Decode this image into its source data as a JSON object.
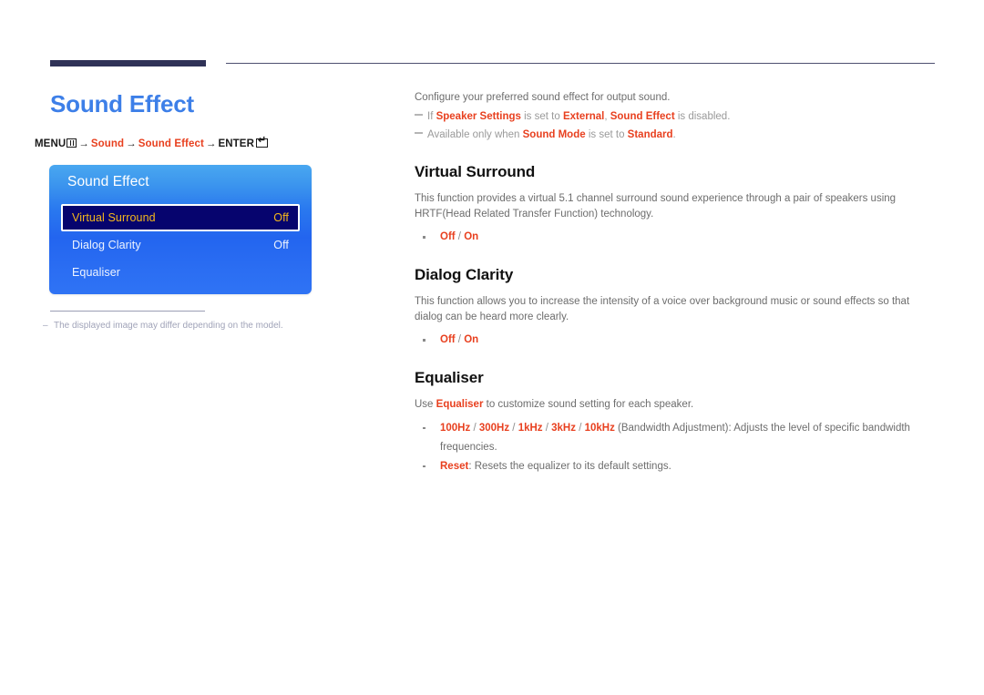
{
  "page": {
    "title": "Sound Effect",
    "accent_blue": "#3d7fe8",
    "accent_red": "#e8401f",
    "rule_navy": "#2f3257"
  },
  "menu_path": {
    "menu_label": "MENU",
    "menu_icon": "menu-grid-icon",
    "arrow": "→",
    "steps": [
      "Sound",
      "Sound Effect"
    ],
    "enter_label": "ENTER",
    "enter_icon": "enter-key-icon"
  },
  "osd": {
    "title": "Sound Effect",
    "highlight_bg": "#06046e",
    "highlight_text": "#f5b81c",
    "rows": [
      {
        "label": "Virtual Surround",
        "value": "Off",
        "selected": true
      },
      {
        "label": "Dialog Clarity",
        "value": "Off",
        "selected": false
      },
      {
        "label": "Equaliser",
        "value": "",
        "selected": false
      }
    ]
  },
  "left_footnote": {
    "dash": "–",
    "text": "The displayed image may differ depending on the model."
  },
  "content": {
    "intro": "Configure your preferred sound effect for output sound.",
    "notes": [
      {
        "parts": [
          {
            "t": "If ",
            "b": false
          },
          {
            "t": "Speaker Settings",
            "b": true
          },
          {
            "t": " is set to ",
            "b": false
          },
          {
            "t": "External",
            "b": true
          },
          {
            "t": ", ",
            "b": false
          },
          {
            "t": "Sound Effect",
            "b": true
          },
          {
            "t": " is disabled.",
            "b": false
          }
        ]
      },
      {
        "parts": [
          {
            "t": "Available only when ",
            "b": false
          },
          {
            "t": "Sound Mode",
            "b": true
          },
          {
            "t": " is set to ",
            "b": false
          },
          {
            "t": "Standard",
            "b": true
          },
          {
            "t": ".",
            "b": false
          }
        ]
      }
    ],
    "sections": [
      {
        "heading": "Virtual Surround",
        "body": "This function provides a virtual 5.1 channel surround sound experience through a pair of speakers using HRTF(Head Related Transfer Function) technology.",
        "bullets": [
          {
            "parts": [
              {
                "t": "Off",
                "b": true
              },
              {
                "t": " / ",
                "b": false,
                "sep": true
              },
              {
                "t": "On",
                "b": true
              }
            ]
          }
        ]
      },
      {
        "heading": "Dialog Clarity",
        "body": "This function allows you to increase the intensity of a voice over background music or sound effects so that dialog can be heard more clearly.",
        "bullets": [
          {
            "parts": [
              {
                "t": "Off",
                "b": true
              },
              {
                "t": " / ",
                "b": false,
                "sep": true
              },
              {
                "t": "On",
                "b": true
              }
            ]
          }
        ]
      },
      {
        "heading": "Equaliser",
        "body_parts": [
          {
            "t": "Use ",
            "b": false
          },
          {
            "t": "Equaliser",
            "b": true
          },
          {
            "t": " to customize sound setting for each speaker.",
            "b": false
          }
        ],
        "bullets": [
          {
            "parts": [
              {
                "t": "100Hz",
                "b": true
              },
              {
                "t": " / ",
                "b": false,
                "sep": true
              },
              {
                "t": "300Hz",
                "b": true
              },
              {
                "t": " / ",
                "b": false,
                "sep": true
              },
              {
                "t": "1kHz",
                "b": true
              },
              {
                "t": " / ",
                "b": false,
                "sep": true
              },
              {
                "t": "3kHz",
                "b": true
              },
              {
                "t": " / ",
                "b": false,
                "sep": true
              },
              {
                "t": "10kHz",
                "b": true
              },
              {
                "t": " (Bandwidth Adjustment): Adjusts the level of specific bandwidth frequencies.",
                "b": false
              }
            ]
          },
          {
            "parts": [
              {
                "t": "Reset",
                "b": true
              },
              {
                "t": ": Resets the equalizer to its default settings.",
                "b": false
              }
            ]
          }
        ]
      }
    ]
  }
}
